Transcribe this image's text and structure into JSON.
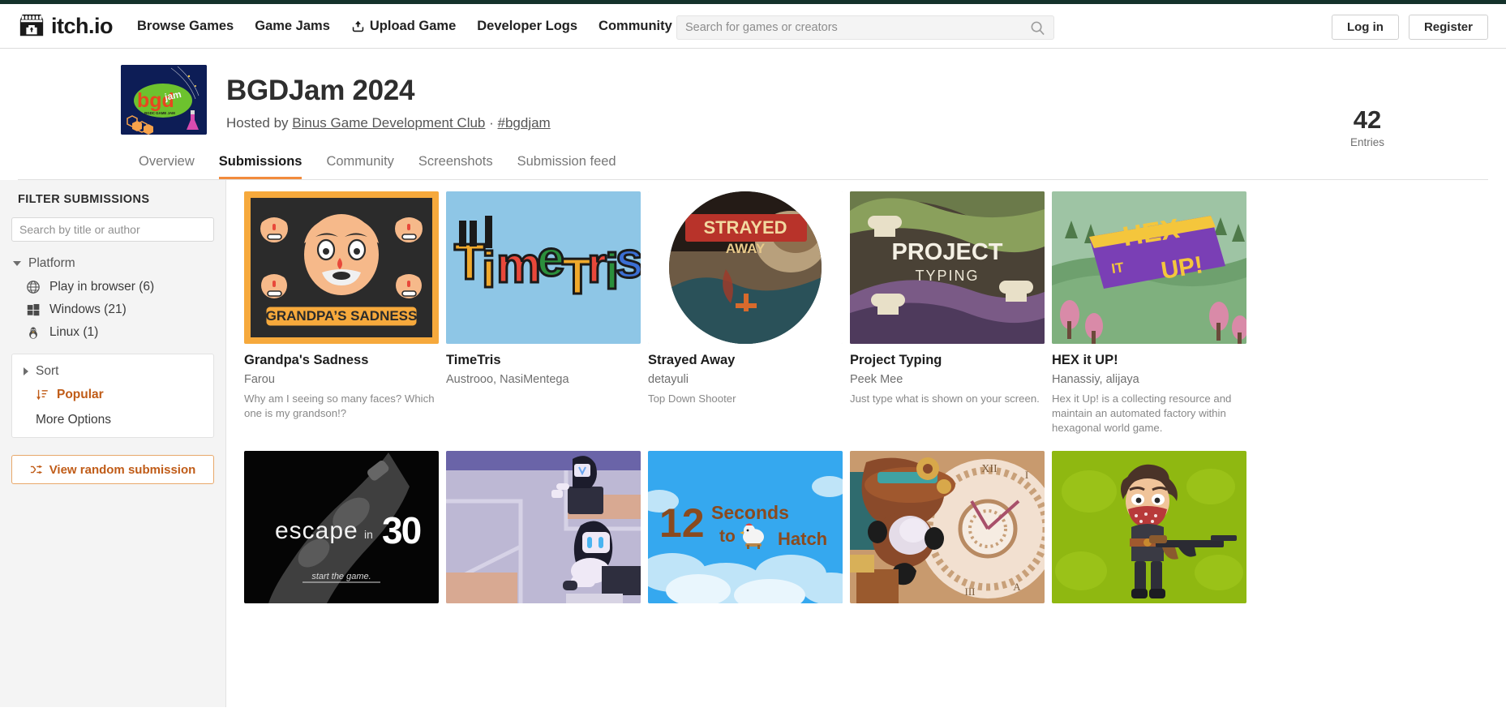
{
  "topbar": {
    "brand": "itch.io",
    "nav": [
      {
        "label": "Browse Games",
        "icon": null
      },
      {
        "label": "Game Jams",
        "icon": null
      },
      {
        "label": "Upload Game",
        "icon": "upload-icon"
      },
      {
        "label": "Developer Logs",
        "icon": null
      },
      {
        "label": "Community",
        "icon": null
      }
    ],
    "search_placeholder": "Search for games or creators",
    "search_value": "",
    "login_label": "Log in",
    "register_label": "Register"
  },
  "jam": {
    "title": "BGDJam 2024",
    "hosted_by_prefix": "Hosted by ",
    "host_name": "Binus Game Development Club",
    "separator": " · ",
    "hashtag": "#bgdjam",
    "entries_count": "42",
    "entries_label": "Entries"
  },
  "tabs": [
    {
      "label": "Overview",
      "active": false
    },
    {
      "label": "Submissions",
      "active": true
    },
    {
      "label": "Community",
      "active": false
    },
    {
      "label": "Screenshots",
      "active": false
    },
    {
      "label": "Submission feed",
      "active": false
    }
  ],
  "sidebar": {
    "heading": "FILTER SUBMISSIONS",
    "search_placeholder": "Search by title or author",
    "search_value": "",
    "platform_group": "Platform",
    "platforms": [
      {
        "label": "Play in browser (6)",
        "icon": "globe-icon"
      },
      {
        "label": "Windows (21)",
        "icon": "windows-icon"
      },
      {
        "label": "Linux (1)",
        "icon": "linux-icon"
      }
    ],
    "sort_group": "Sort",
    "sort_selected": "Popular",
    "more_options": "More Options",
    "random_button": "View random submission"
  },
  "accent_color": "#f28b3c",
  "sort_color": "#c05c18",
  "submissions": [
    {
      "title": "Grandpa's Sadness",
      "author": "Farou",
      "desc": "Why am I seeing so many faces? Which one is my grandson!?",
      "thumb": "grandpas-sadness-thumb"
    },
    {
      "title": "TimeTris",
      "author": "Austrooo, NasiMentega",
      "desc": "",
      "thumb": "timetris-thumb"
    },
    {
      "title": "Strayed Away",
      "author": "detayuli",
      "desc": "Top Down Shooter",
      "thumb": "strayed-away-thumb"
    },
    {
      "title": "Project Typing",
      "author": "Peek Mee",
      "desc": "Just type what is shown on your screen.",
      "thumb": "project-typing-thumb"
    },
    {
      "title": "HEX it UP!",
      "author": "Hanassiy, alijaya",
      "desc": "Hex it Up! is a collecting resource and maintain an automated factory within hexagonal world game.",
      "thumb": "hex-it-up-thumb"
    },
    {
      "title": "",
      "author": "",
      "desc": "",
      "thumb": "escape-in-30-thumb"
    },
    {
      "title": "",
      "author": "",
      "desc": "",
      "thumb": "robot-office-thumb"
    },
    {
      "title": "",
      "author": "",
      "desc": "",
      "thumb": "12-seconds-to-hatch-thumb"
    },
    {
      "title": "",
      "author": "",
      "desc": "",
      "thumb": "steampunk-clock-thumb"
    },
    {
      "title": "",
      "author": "",
      "desc": "",
      "thumb": "bandit-shooter-thumb"
    }
  ],
  "thumb_art": {
    "grandpas_sadness_caption": "GRANDPA'S SADNESS",
    "escape_title": "escape",
    "escape_in": "in",
    "escape_num": "30",
    "escape_sub": "start the game.",
    "hatch_num": "12",
    "hatch_line1": "Seconds",
    "hatch_line2": "to",
    "hatch_line3": "Hatch",
    "strayed_line1": "STRAYED",
    "strayed_line2": "AWAY",
    "project_line1": "PROJECT",
    "project_line2": "TYPING",
    "hex_line1": "HEX",
    "hex_line2": "IT",
    "hex_line3": "UP!",
    "timetris": "TimeTris",
    "jam_logo_text": "bgd",
    "jam_logo_sub": "BGDC GAME JAM",
    "clock_numeral": "XII"
  }
}
